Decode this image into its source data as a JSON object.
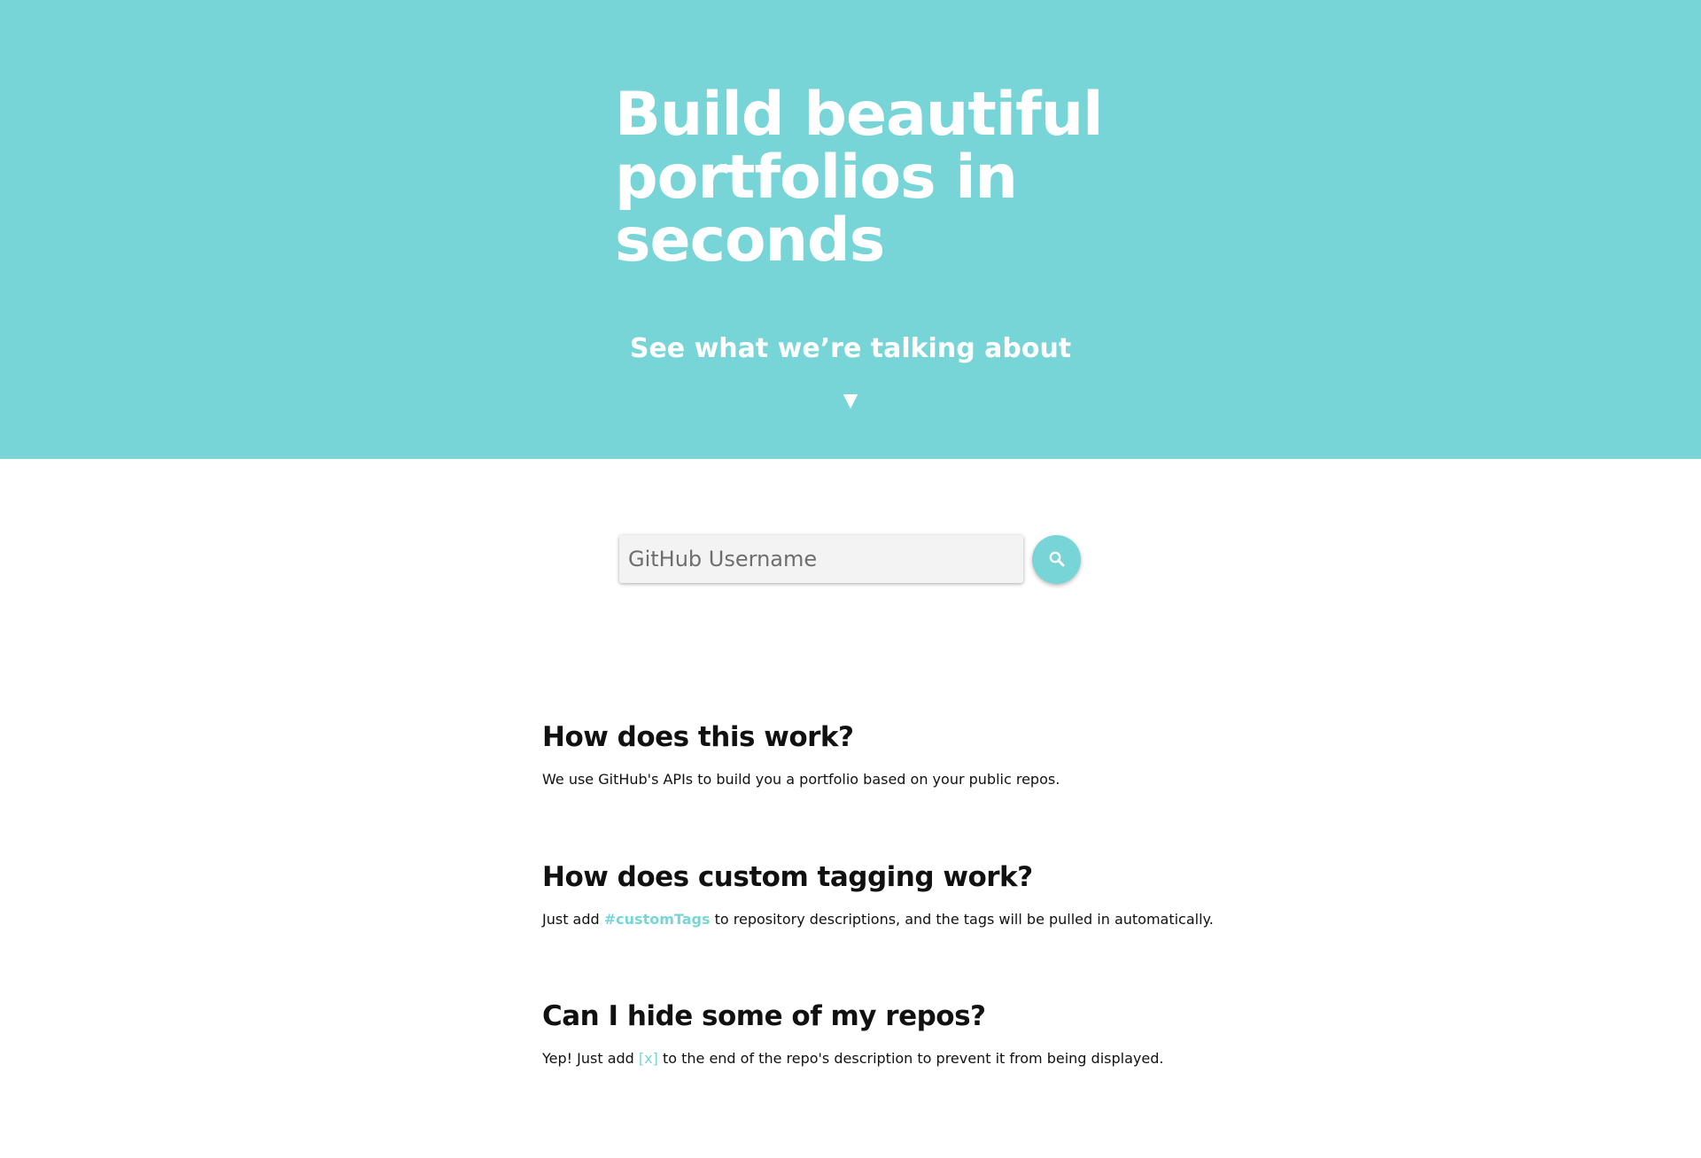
{
  "hero": {
    "title_line1": "Build beautiful",
    "title_line2": "portfolios in",
    "title_line3": "seconds",
    "cta_text": "See what we’re talking about",
    "arrow_glyph": "▼"
  },
  "search": {
    "placeholder": "GitHub Username",
    "value": "",
    "button_icon": "search-icon"
  },
  "faq": [
    {
      "question": "How does this work?",
      "answer": "We use GitHub's APIs to build you a portfolio based on your public repos."
    },
    {
      "question": "How does custom tagging work?",
      "answer_before": "Just add ",
      "answer_highlight": "#customTags",
      "answer_after": " to repository descriptions, and the tags will be pulled in automatically."
    },
    {
      "question": "Can I hide some of my repos?",
      "answer_before": "Yep! Just add ",
      "answer_highlight": "[x]",
      "answer_after": " to the end of the repo's description to prevent it from being displayed."
    }
  ],
  "colors": {
    "accent": "#78d5d7",
    "text": "#111111",
    "input_bg": "#f3f3f3"
  }
}
